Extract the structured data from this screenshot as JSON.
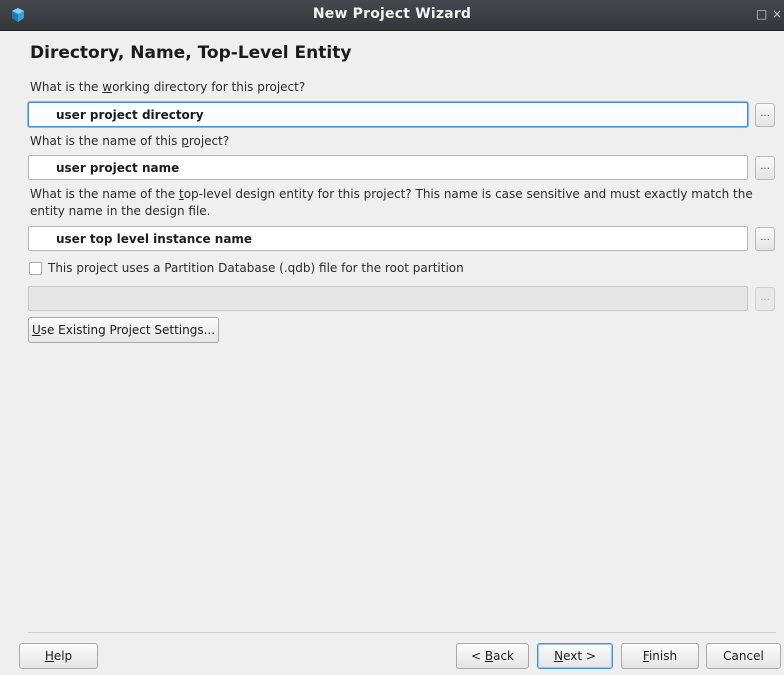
{
  "window": {
    "title": "New Project Wizard",
    "maximize_glyph": "□",
    "close_glyph": "×"
  },
  "page": {
    "heading": "Directory, Name, Top-Level Entity"
  },
  "directory": {
    "label_pre": "What is the ",
    "label_mnemonic": "w",
    "label_post": "orking directory for this project?",
    "value": "user project directory",
    "browse_label": "..."
  },
  "project_name": {
    "label_pre": "What is the name of this ",
    "label_mnemonic": "p",
    "label_post": "roject?",
    "value": "user project name",
    "browse_label": "..."
  },
  "top_level": {
    "label_pre": "What is the name of the ",
    "label_mnemonic": "t",
    "label_post": "op-level design entity for this project? This name is case sensitive and must exactly match the",
    "label_line2": "entity name in the design file.",
    "value": "user top level instance name",
    "browse_label": "..."
  },
  "partition": {
    "checked": false,
    "label": "This project uses a Partition Database (.qdb) file for the root partition",
    "value": "",
    "browse_label": "..."
  },
  "existing_settings": {
    "mnemonic": "U",
    "label_rest": "se Existing Project Settings..."
  },
  "footer": {
    "help_mnemonic": "H",
    "help_rest": "elp",
    "back_pre": "< ",
    "back_mnemonic": "B",
    "back_rest": "ack",
    "next_mnemonic": "N",
    "next_rest": "ext >",
    "finish_mnemonic": "F",
    "finish_rest": "inish",
    "cancel_label": "Cancel"
  },
  "colors": {
    "titlebar": "#3c3e42",
    "focus_accent": "#4a90d9",
    "dialog_bg": "#efefef"
  }
}
